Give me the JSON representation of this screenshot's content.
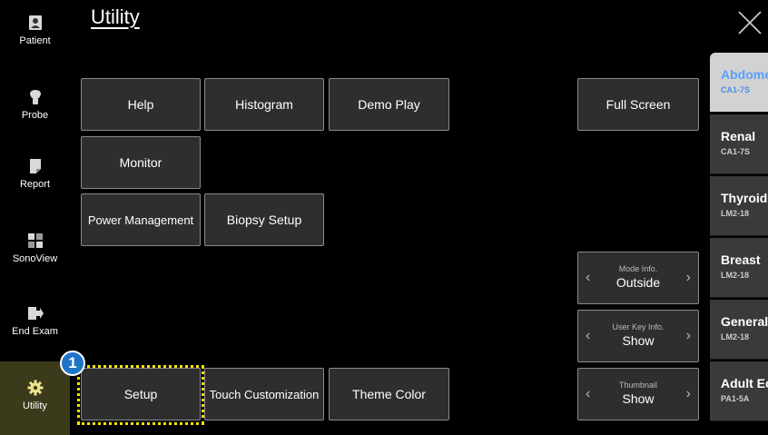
{
  "title": "Utility",
  "sidebar": {
    "items": [
      {
        "label": "Patient",
        "icon": "patient-icon"
      },
      {
        "label": "Probe",
        "icon": "probe-icon"
      },
      {
        "label": "Report",
        "icon": "report-icon"
      },
      {
        "label": "SonoView",
        "icon": "sonoview-icon"
      },
      {
        "label": "End Exam",
        "icon": "end-exam-icon"
      },
      {
        "label": "Utility",
        "icon": "gear-icon",
        "active": true
      }
    ]
  },
  "buttons": {
    "help": "Help",
    "histogram": "Histogram",
    "demo_play": "Demo Play",
    "full_screen": "Full Screen",
    "monitor": "Monitor",
    "power_management": "Power Management",
    "biopsy_setup": "Biopsy Setup",
    "setup": "Setup",
    "touch_customization": "Touch Customization",
    "theme_color": "Theme Color"
  },
  "steppers": [
    {
      "label": "Mode Info.",
      "value": "Outside"
    },
    {
      "label": "User Key Info.",
      "value": "Show"
    },
    {
      "label": "Thumbnail",
      "value": "Show"
    }
  ],
  "presets": [
    {
      "name": "Abdomen",
      "probe": "CA1-7S",
      "active": true
    },
    {
      "name": "Renal",
      "probe": "CA1-7S"
    },
    {
      "name": "Thyroid",
      "probe": "LM2-18"
    },
    {
      "name": "Breast",
      "probe": "LM2-18"
    },
    {
      "name": "General",
      "probe": "LM2-18"
    },
    {
      "name": "Adult Echo",
      "probe": "PA1-5A"
    }
  ],
  "annotation": {
    "badge": "1"
  },
  "colors": {
    "accent_active_preset": "#5aa0ff",
    "highlight_dashed": "#f5e400",
    "badge_bg": "#1e73c8",
    "active_sidebar_bg": "#3b3b1c"
  }
}
